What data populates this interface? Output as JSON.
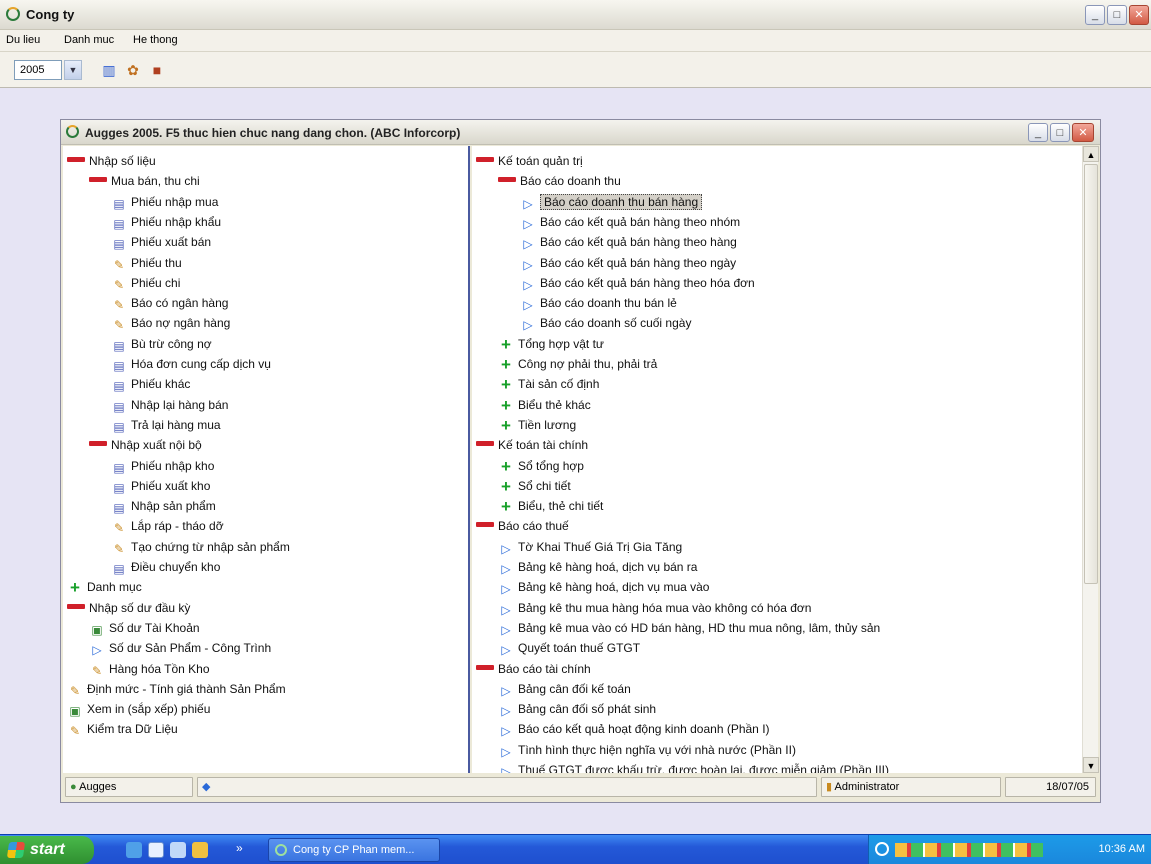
{
  "app": {
    "title": "Cong ty",
    "menu": [
      "Du lieu",
      "Danh muc",
      "He thong"
    ],
    "year_value": "2005"
  },
  "child_window": {
    "title": "Augges 2005. F5 thuc hien chuc nang dang chon. (ABC Inforcorp)"
  },
  "tree_left": [
    {
      "label": "Nhập số liệu",
      "icon": "minus"
    },
    {
      "label": "Mua bán, thu chi",
      "icon": "minus"
    },
    {
      "label": "Phiếu nhập mua",
      "icon": "doc"
    },
    {
      "label": "Phiếu nhập khẩu",
      "icon": "doc"
    },
    {
      "label": "Phiếu xuất bán",
      "icon": "doc"
    },
    {
      "label": "Phiếu thu",
      "icon": "gold"
    },
    {
      "label": "Phiếu chi",
      "icon": "gold"
    },
    {
      "label": "Báo có ngân hàng",
      "icon": "gold"
    },
    {
      "label": "Báo nợ ngân hàng",
      "icon": "gold"
    },
    {
      "label": "Bù trừ công nợ",
      "icon": "doc"
    },
    {
      "label": "Hóa đơn cung cấp dịch vụ",
      "icon": "doc"
    },
    {
      "label": "Phiếu khác",
      "icon": "doc"
    },
    {
      "label": "Nhập lại hàng bán",
      "icon": "doc"
    },
    {
      "label": "Trả lại hàng mua",
      "icon": "doc"
    },
    {
      "label": "Nhập xuất nội bộ",
      "icon": "minus"
    },
    {
      "label": "Phiếu nhập kho",
      "icon": "doc"
    },
    {
      "label": "Phiếu xuất kho",
      "icon": "doc"
    },
    {
      "label": "Nhập sản phẩm",
      "icon": "doc"
    },
    {
      "label": "Lắp ráp - tháo dỡ",
      "icon": "gold"
    },
    {
      "label": "Tạo chứng từ nhập sản phẩm",
      "icon": "gold"
    },
    {
      "label": "Điều chuyển kho",
      "icon": "doc"
    },
    {
      "label": "Danh mục",
      "icon": "plus"
    },
    {
      "label": "Nhập số dư đầu kỳ",
      "icon": "minus"
    },
    {
      "label": "Số dư Tài Khoản",
      "icon": "green"
    },
    {
      "label": "Số dư Sản Phẩm - Công Trình",
      "icon": "arrow"
    },
    {
      "label": "Hàng hóa Tồn Kho",
      "icon": "gold"
    },
    {
      "label": "Định mức - Tính giá thành Sản Phẩm",
      "icon": "gold"
    },
    {
      "label": "Xem in (sắp xếp) phiếu",
      "icon": "green"
    },
    {
      "label": "Kiểm tra Dữ Liệu",
      "icon": "gold"
    }
  ],
  "tree_right": [
    {
      "label": "Kế toán quản trị",
      "icon": "minus"
    },
    {
      "label": "Báo cáo doanh thu",
      "icon": "minus"
    },
    {
      "label": "Báo cáo doanh thu bán hàng",
      "icon": "arrow",
      "selected": true
    },
    {
      "label": "Báo cáo kết quả bán hàng theo nhóm",
      "icon": "arrow"
    },
    {
      "label": "Báo cáo kết quả bán hàng theo hàng",
      "icon": "arrow"
    },
    {
      "label": "Báo cáo kết quả bán hàng theo ngày",
      "icon": "arrow"
    },
    {
      "label": "Báo cáo kết quả bán hàng theo hóa đơn",
      "icon": "arrow"
    },
    {
      "label": "Báo cáo doanh thu bán lẻ",
      "icon": "arrow"
    },
    {
      "label": "Báo cáo doanh số cuối ngày",
      "icon": "arrow"
    },
    {
      "label": "Tổng hợp vật tư",
      "icon": "plus"
    },
    {
      "label": "Công nợ phải thu, phải trả",
      "icon": "plus"
    },
    {
      "label": "Tài sản cố định",
      "icon": "plus"
    },
    {
      "label": "Biểu thẻ khác",
      "icon": "plus"
    },
    {
      "label": "Tiền lương",
      "icon": "plus"
    },
    {
      "label": "Kế toán tài chính",
      "icon": "minus"
    },
    {
      "label": "Sổ tổng hợp",
      "icon": "plus"
    },
    {
      "label": "Sổ chi tiết",
      "icon": "plus"
    },
    {
      "label": "Biểu, thẻ chi tiết",
      "icon": "plus"
    },
    {
      "label": "Báo cáo thuế",
      "icon": "minus"
    },
    {
      "label": "Tờ Khai Thuế Giá Trị Gia Tăng",
      "icon": "arrow"
    },
    {
      "label": "Bảng kê hàng hoá, dịch vụ bán ra",
      "icon": "arrow"
    },
    {
      "label": "Bảng kê hàng hoá, dịch vụ mua vào",
      "icon": "arrow"
    },
    {
      "label": "Bảng kê thu mua hàng hóa mua vào không có hóa đơn",
      "icon": "arrow"
    },
    {
      "label": "Bảng kê mua vào có HD bán hàng, HD thu mua nông, lâm, thủy sản",
      "icon": "arrow"
    },
    {
      "label": "Quyết toán thuế GTGT",
      "icon": "arrow"
    },
    {
      "label": "Báo cáo tài chính",
      "icon": "minus"
    },
    {
      "label": "Bảng cân đối kế toán",
      "icon": "arrow"
    },
    {
      "label": "Bảng cân đối số phát sinh",
      "icon": "arrow"
    },
    {
      "label": "Báo cáo kết quả hoạt động kinh doanh (Phần I)",
      "icon": "arrow"
    },
    {
      "label": "Tình hình thực hiện nghĩa vụ với nhà nước (Phần II)",
      "icon": "arrow"
    },
    {
      "label": "Thuế GTGT được khấu trừ, được hoàn lại, được miễn giảm (Phần III)",
      "icon": "arrow"
    }
  ],
  "status": {
    "app_name": "Augges",
    "user": "Administrator",
    "date": "18/07/05"
  },
  "taskbar": {
    "start_label": "start",
    "task_item": "Cong ty CP Phan mem...",
    "clock": "10:36 AM"
  }
}
